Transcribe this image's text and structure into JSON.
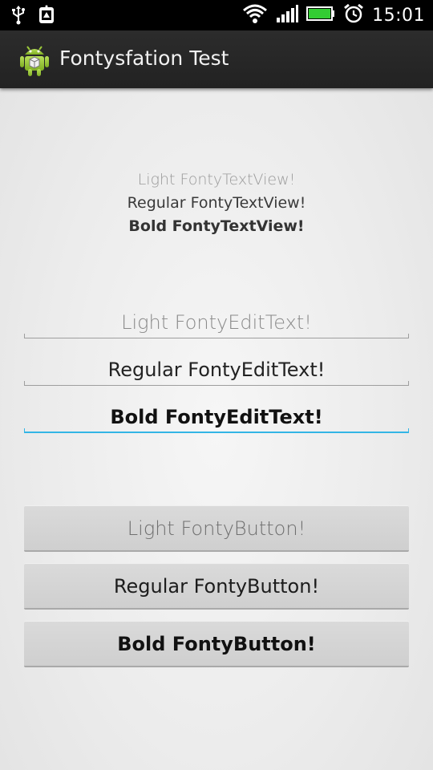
{
  "status_bar": {
    "time": "15:01",
    "icons": [
      "usb-icon",
      "android-debug-icon",
      "wifi-icon",
      "signal-icon",
      "battery-icon",
      "alarm-icon"
    ],
    "battery_color": "#33cc33"
  },
  "action_bar": {
    "title": "Fontysfation Test",
    "icon": "android-app-icon"
  },
  "text_views": {
    "light": "Light FontyTextView!",
    "regular": "Regular FontyTextView!",
    "bold": "Bold FontyTextView!"
  },
  "edit_texts": {
    "light": "Light FontyEditText!",
    "regular": "Regular FontyEditText!",
    "bold": "Bold FontyEditText!",
    "focused_underline_color": "#33b5e5"
  },
  "buttons": {
    "light": "Light FontyButton!",
    "regular": "Regular FontyButton!",
    "bold": "Bold FontyButton!"
  }
}
